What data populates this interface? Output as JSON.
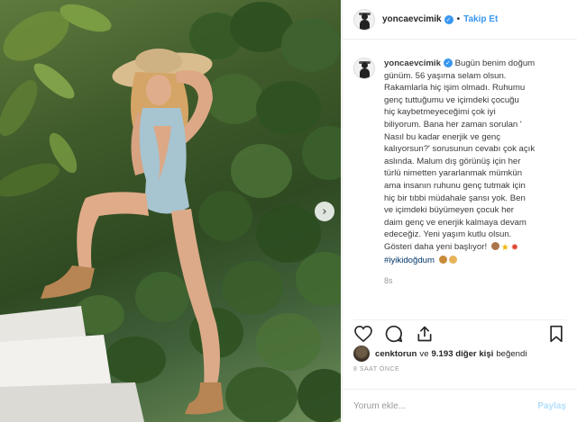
{
  "post": {
    "username": "yoncaevcimik",
    "follow_label": "Takip Et",
    "dot": "•",
    "caption_lines": [
      "Bugün benim doğum",
      "günüm. 56 yaşıma selam olsun.",
      "Rakamlarla hiç işim olmadı. Ruhumu",
      "genç tuttuğumu ve içimdeki çocuğu",
      "hiç kaybetmeyeceğimi çok iyi",
      "biliyorum. Bana her zaman sorulan '",
      "Nasıl bu kadar enerjik ve genç",
      "kalıyorsun?' sorusunun cevabı çok açık",
      "aslında. Malum dış görünüş için her",
      "türlü nimetten yararlanmak mümkün",
      "ama insanın ruhunu genç tutmak için",
      "hiç bir tıbbi müdahale şansı yok. Ben",
      "ve içimdeki büyümeyen çocuk her",
      "daim genç ve enerjik kalmaya devam",
      "edeceğiz. Yeni yaşım kutlu olsun.",
      "Gösteri daha yeni başlıyor!"
    ],
    "hashtag": "#iyikidoğdum",
    "time_ago": "8s",
    "likes": {
      "liker": "cenktorun",
      "connector": "ve",
      "others": "9.193 diğer kişi",
      "suffix": "beğendi"
    },
    "date": "8 SAAT ÖNCE",
    "comment": {
      "placeholder": "Yorum ekle...",
      "post_label": "Paylaş"
    }
  },
  "icons": {
    "verified": "verified-badge-icon",
    "next": "chevron-right-icon",
    "like": "heart-icon",
    "comment": "comment-icon",
    "share": "share-icon",
    "save": "bookmark-icon"
  },
  "colors": {
    "accent": "#3897f0",
    "hashtag": "#003569",
    "muted": "#999999",
    "post_disabled": "#b2dffc"
  }
}
